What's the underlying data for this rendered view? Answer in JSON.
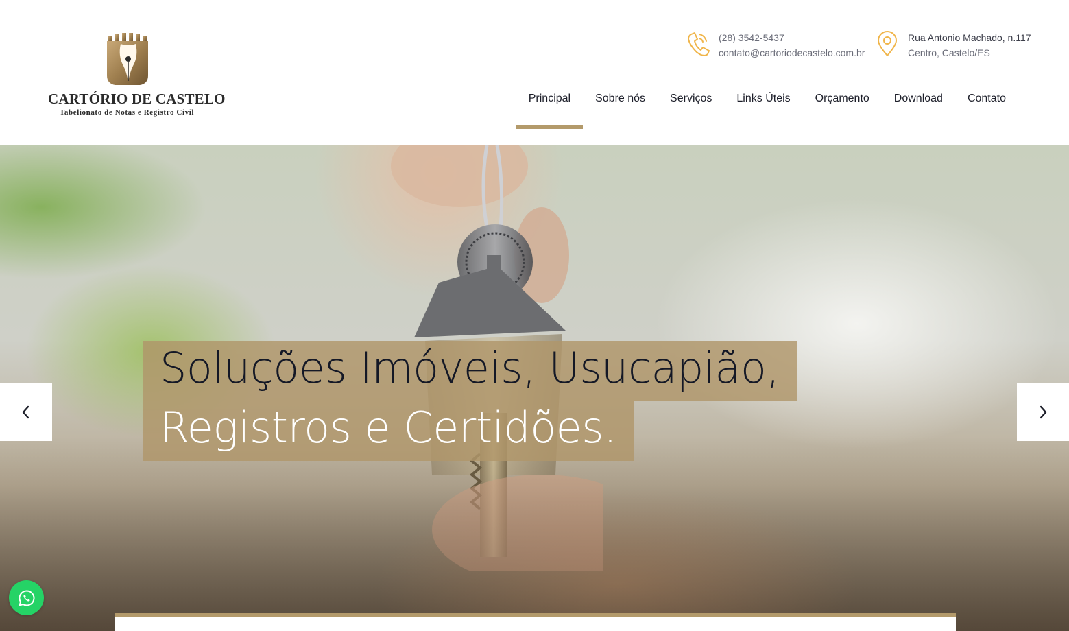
{
  "brand": {
    "title": "CARTÓRIO DE CASTELO",
    "subtitle": "Tabelionato de Notas e Registro Civil",
    "accent_color": "#b39a6b",
    "emblem_icon": "pen-nib-castle-logo"
  },
  "contact": {
    "phone": "(28) 3542-5437",
    "email": "contato@cartoriodecastelo.com.br",
    "address_line1": "Rua Antonio Machado, n.117",
    "address_line2": "Centro, Castelo/ES",
    "phone_icon": "phone-icon",
    "location_icon": "map-pin-icon",
    "icon_color": "#f0b54a"
  },
  "nav": {
    "items": [
      {
        "label": "Principal",
        "active": true
      },
      {
        "label": "Sobre nós"
      },
      {
        "label": "Serviços"
      },
      {
        "label": "Links Úteis"
      },
      {
        "label": "Orçamento"
      },
      {
        "label": "Download"
      },
      {
        "label": "Contato"
      }
    ]
  },
  "hero": {
    "line1": "Soluções Imóveis, Usucapião,",
    "line2": "Registros e Certidões.",
    "prev_icon": "chevron-left-icon",
    "next_icon": "chevron-right-icon"
  },
  "floating": {
    "whatsapp_icon": "whatsapp-icon",
    "whatsapp_color": "#25d366"
  }
}
